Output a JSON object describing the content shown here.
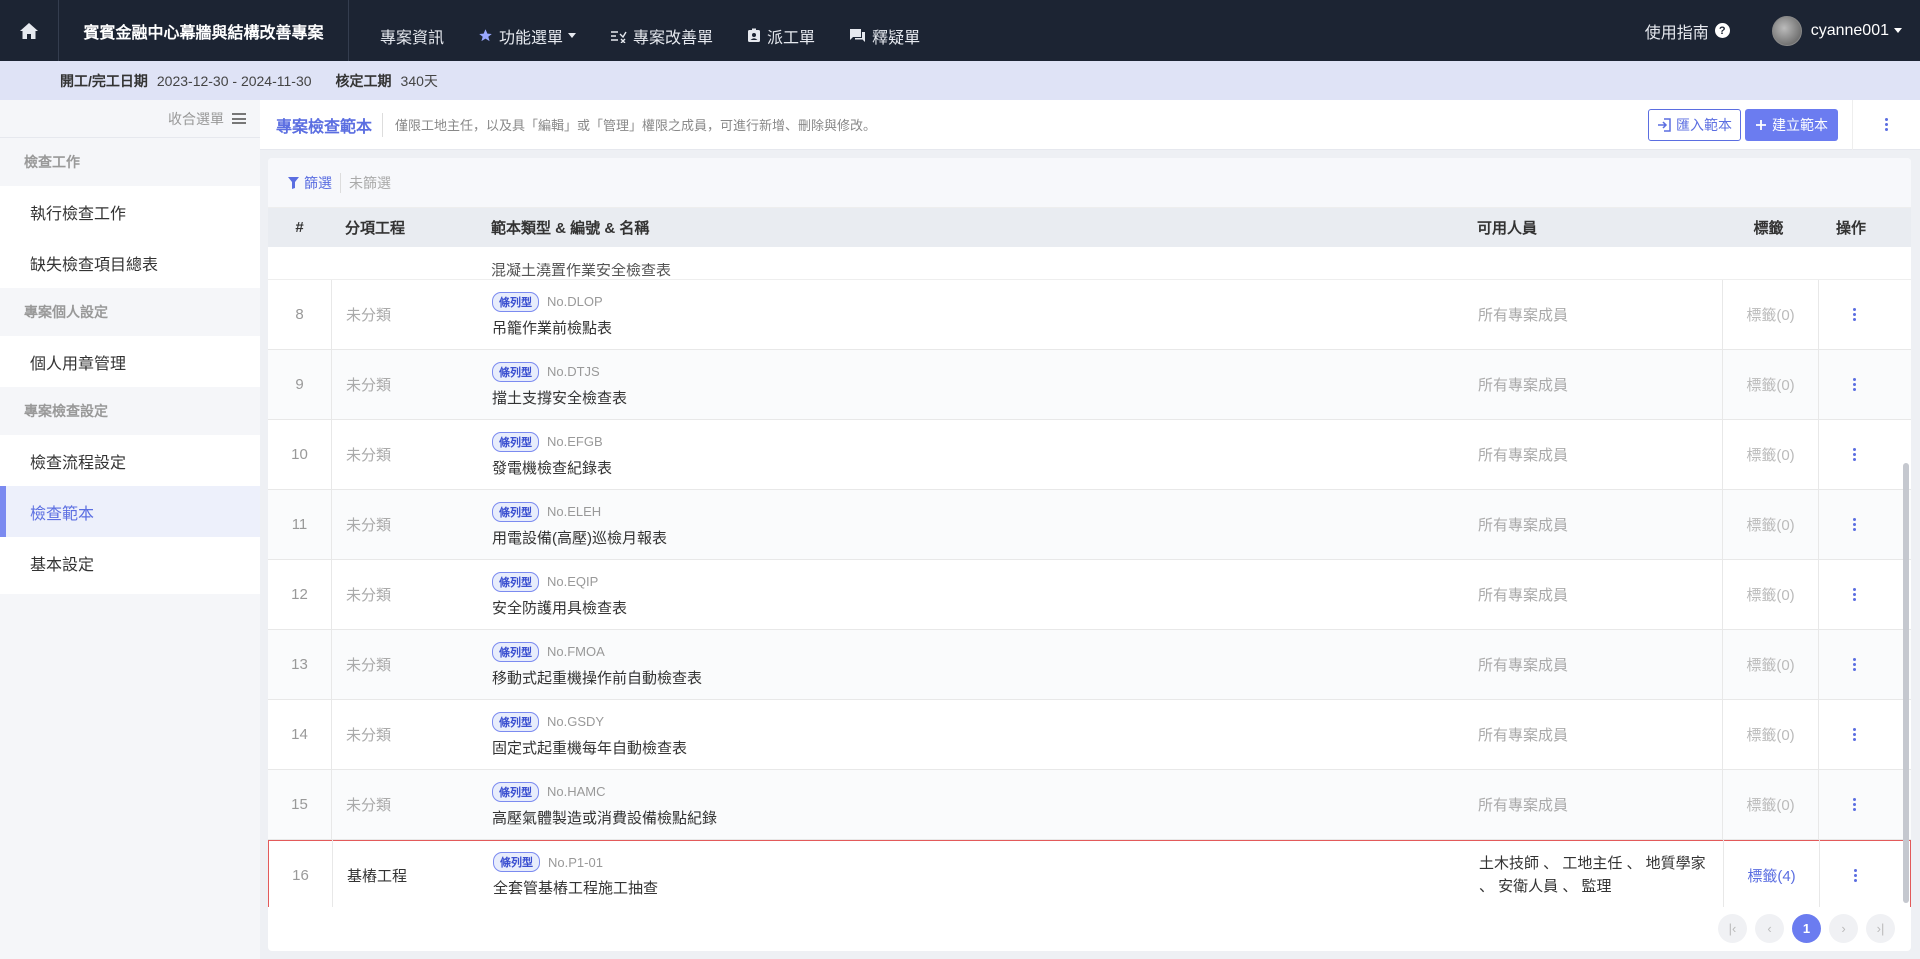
{
  "topbar": {
    "project_title": "賓賓金融中心幕牆與結構改善專案",
    "nav": [
      {
        "label": "專案資訊",
        "icon": "none"
      },
      {
        "label": "功能選單",
        "icon": "star-icon"
      },
      {
        "label": "專案改善單",
        "icon": "list-check-icon"
      },
      {
        "label": "派工單",
        "icon": "badge-icon"
      },
      {
        "label": "釋疑單",
        "icon": "chat-icon"
      }
    ],
    "guide_label": "使用指南",
    "username": "cyanne001"
  },
  "infobar": {
    "date_label": "開工/完工日期",
    "date_value": "2023-12-30 - 2024-11-30",
    "duration_label": "核定工期",
    "duration_value": "340天"
  },
  "sidebar": {
    "collapse_label": "收合選單",
    "sections": [
      {
        "title": "檢查工作",
        "items": [
          "執行檢查工作",
          "缺失檢查項目總表"
        ]
      },
      {
        "title": "專案個人設定",
        "items": [
          "個人用章管理"
        ]
      },
      {
        "title": "專案檢查設定",
        "items": [
          "檢查流程設定",
          "檢查範本",
          "基本設定"
        ]
      }
    ],
    "active_item": "檢查範本"
  },
  "pagehead": {
    "title": "專案檢查範本",
    "desc": "僅限工地主任，以及具「編輯」或「管理」權限之成員，可進行新增、刪除與修改。",
    "import_label": "匯入範本",
    "create_label": "建立範本"
  },
  "filter": {
    "label": "篩選",
    "state": "未篩選"
  },
  "table": {
    "headers": [
      "#",
      "分項工程",
      "範本類型 & 編號 & 名稱",
      "可用人員",
      "標籤",
      "操作"
    ],
    "partial_row_name": "混凝土澆置作業安全檢查表",
    "rows": [
      {
        "idx": "8",
        "cat": "未分類",
        "type": "條列型",
        "code": "No.DLOP",
        "name": "吊籠作業前檢點表",
        "users": "所有專案成員",
        "tag": "標籤(0)"
      },
      {
        "idx": "9",
        "cat": "未分類",
        "type": "條列型",
        "code": "No.DTJS",
        "name": "擋土支撐安全檢查表",
        "users": "所有專案成員",
        "tag": "標籤(0)"
      },
      {
        "idx": "10",
        "cat": "未分類",
        "type": "條列型",
        "code": "No.EFGB",
        "name": "發電機檢查紀錄表",
        "users": "所有專案成員",
        "tag": "標籤(0)"
      },
      {
        "idx": "11",
        "cat": "未分類",
        "type": "條列型",
        "code": "No.ELEH",
        "name": "用電設備(高壓)巡檢月報表",
        "users": "所有專案成員",
        "tag": "標籤(0)"
      },
      {
        "idx": "12",
        "cat": "未分類",
        "type": "條列型",
        "code": "No.EQIP",
        "name": "安全防護用具檢查表",
        "users": "所有專案成員",
        "tag": "標籤(0)"
      },
      {
        "idx": "13",
        "cat": "未分類",
        "type": "條列型",
        "code": "No.FMOA",
        "name": "移動式起重機操作前自動檢查表",
        "users": "所有專案成員",
        "tag": "標籤(0)"
      },
      {
        "idx": "14",
        "cat": "未分類",
        "type": "條列型",
        "code": "No.GSDY",
        "name": "固定式起重機每年自動檢查表",
        "users": "所有專案成員",
        "tag": "標籤(0)"
      },
      {
        "idx": "15",
        "cat": "未分類",
        "type": "條列型",
        "code": "No.HAMC",
        "name": "高壓氣體製造或消費設備檢點紀錄",
        "users": "所有專案成員",
        "tag": "標籤(0)"
      },
      {
        "idx": "16",
        "cat": "基樁工程",
        "type": "條列型",
        "code": "No.P1-01",
        "name": "全套管基樁工程施工抽查",
        "users": "土木技師 、 工地主任 、 地質學家 、 安衛人員 、 監理",
        "tag": "標籤(4)"
      }
    ]
  },
  "pager": {
    "current": "1"
  },
  "colors": {
    "accent": "#5b6ee1",
    "topbar": "#1c2433",
    "highlight_border": "#e35a5a"
  }
}
